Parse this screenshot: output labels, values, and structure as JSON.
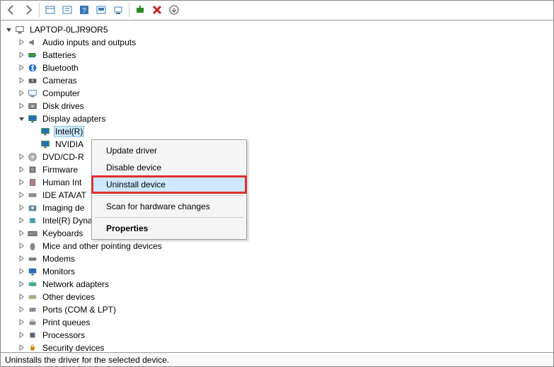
{
  "root": {
    "label": "LAPTOP-0LJR9OR5",
    "expanded": true
  },
  "categories": [
    {
      "label": "Audio inputs and outputs",
      "expanded": false,
      "icon": "speaker"
    },
    {
      "label": "Batteries",
      "expanded": false,
      "icon": "battery"
    },
    {
      "label": "Bluetooth",
      "expanded": false,
      "icon": "bluetooth"
    },
    {
      "label": "Cameras",
      "expanded": false,
      "icon": "camera"
    },
    {
      "label": "Computer",
      "expanded": false,
      "icon": "computer"
    },
    {
      "label": "Disk drives",
      "expanded": false,
      "icon": "disk"
    },
    {
      "label": "Display adapters",
      "expanded": true,
      "icon": "display",
      "children": [
        {
          "label": "Intel(R)",
          "selected": true
        },
        {
          "label": "NVIDIA"
        }
      ]
    },
    {
      "label": "DVD/CD-R",
      "expanded": false,
      "icon": "dvd"
    },
    {
      "label": "Firmware",
      "expanded": false,
      "icon": "firmware"
    },
    {
      "label": "Human Int",
      "expanded": false,
      "icon": "hid"
    },
    {
      "label": "IDE ATA/AT",
      "expanded": false,
      "icon": "ide"
    },
    {
      "label": "Imaging de",
      "expanded": false,
      "icon": "imaging"
    },
    {
      "label": "Intel(R) Dynamic Platform and Thermal Framework",
      "expanded": false,
      "icon": "chip"
    },
    {
      "label": "Keyboards",
      "expanded": false,
      "icon": "keyboard"
    },
    {
      "label": "Mice and other pointing devices",
      "expanded": false,
      "icon": "mouse"
    },
    {
      "label": "Modems",
      "expanded": false,
      "icon": "modem"
    },
    {
      "label": "Monitors",
      "expanded": false,
      "icon": "monitor"
    },
    {
      "label": "Network adapters",
      "expanded": false,
      "icon": "network"
    },
    {
      "label": "Other devices",
      "expanded": false,
      "icon": "other"
    },
    {
      "label": "Ports (COM & LPT)",
      "expanded": false,
      "icon": "port"
    },
    {
      "label": "Print queues",
      "expanded": false,
      "icon": "printer"
    },
    {
      "label": "Processors",
      "expanded": false,
      "icon": "cpu"
    },
    {
      "label": "Security devices",
      "expanded": false,
      "icon": "security"
    }
  ],
  "context_menu": {
    "items": [
      {
        "label": "Update driver"
      },
      {
        "label": "Disable device"
      },
      {
        "label": "Uninstall device",
        "highlighted": true,
        "hovered": true
      },
      {
        "sep": true
      },
      {
        "label": "Scan for hardware changes"
      },
      {
        "sep": true
      },
      {
        "label": "Properties",
        "bold": true
      }
    ]
  },
  "statusbar": {
    "text": "Uninstalls the driver for the selected device."
  },
  "toolbar_icons": [
    "back",
    "forward",
    "|",
    "show-hidden",
    "properties",
    "help",
    "update",
    "scan",
    "|",
    "add-legacy",
    "remove",
    "more"
  ]
}
